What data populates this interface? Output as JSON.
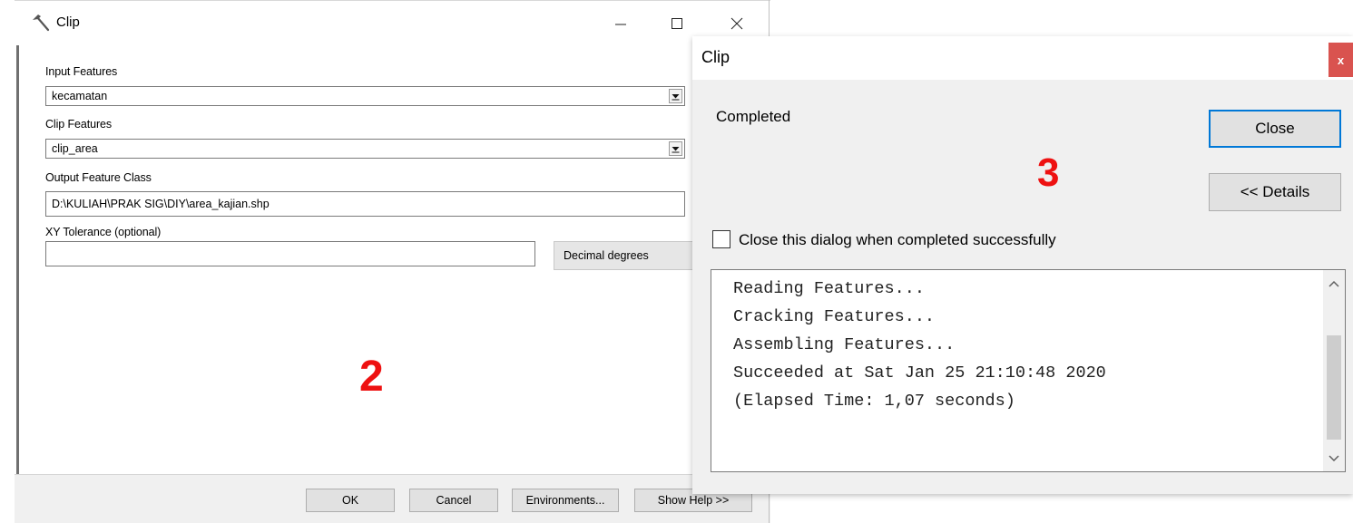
{
  "tool_window": {
    "title": "Clip",
    "labels": {
      "input_features": "Input Features",
      "clip_features": "Clip Features",
      "output_feature_class": "Output Feature Class",
      "xy_tolerance": "XY Tolerance (optional)"
    },
    "values": {
      "input_features": "kecamatan",
      "clip_features": "clip_area",
      "output_feature_class": "D:\\KULIAH\\PRAK SIG\\DIY\\area_kajian.shp",
      "xy_tolerance": "",
      "tolerance_units": "Decimal degrees"
    },
    "annotation_number": "2",
    "buttons": {
      "ok": "OK",
      "cancel": "Cancel",
      "environments": "Environments...",
      "show_help": "Show Help >>"
    }
  },
  "progress_window": {
    "title": "Clip",
    "close_x": "x",
    "status": "Completed",
    "annotation_number": "3",
    "buttons": {
      "close": "Close",
      "details": "<< Details"
    },
    "checkbox_label": "Close this dialog when completed successfully",
    "checkbox_checked": false,
    "log_lines": [
      "Reading Features...",
      "Cracking Features...",
      "Assembling Features...",
      "Succeeded at Sat Jan 25 21:10:48 2020",
      "(Elapsed Time: 1,07 seconds)"
    ]
  },
  "colors": {
    "annotation_red": "#ee1111",
    "focus_blue": "#0078d7",
    "close_red": "#d9534f"
  }
}
